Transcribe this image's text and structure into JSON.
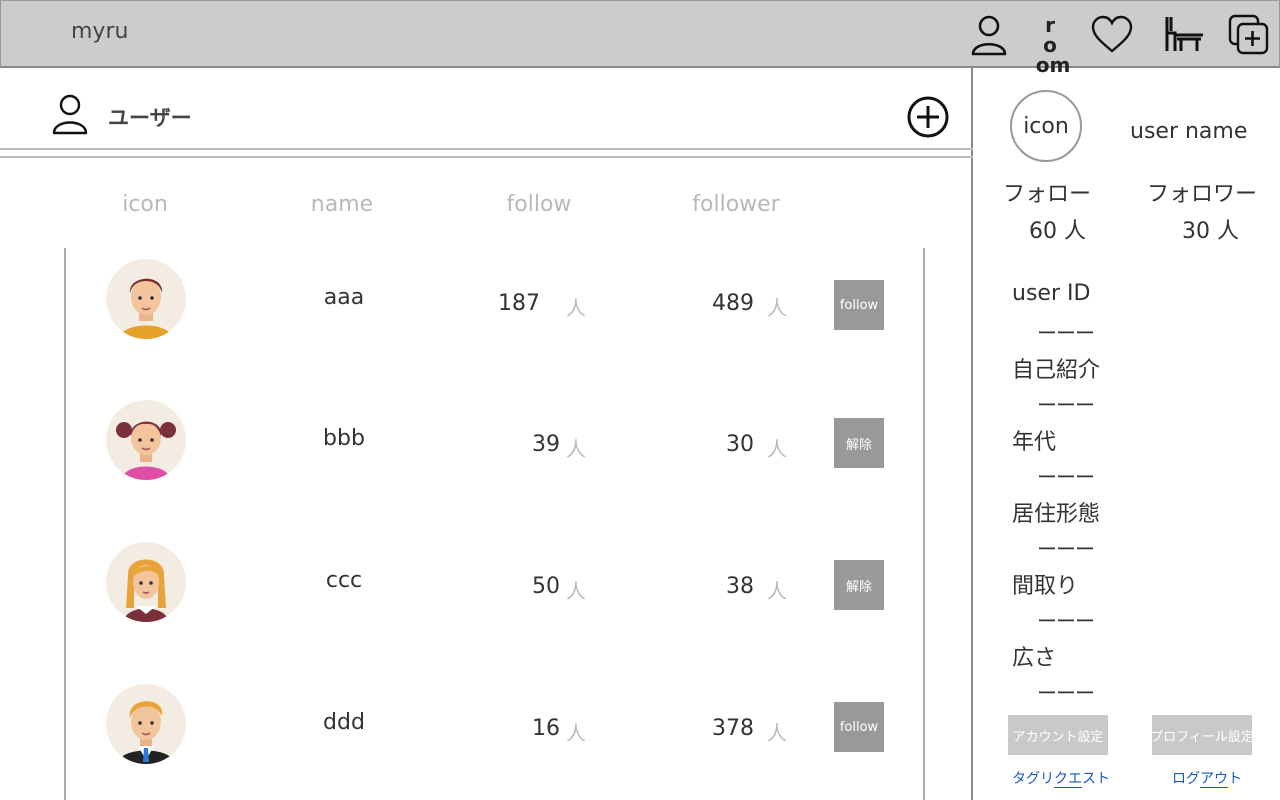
{
  "app": {
    "brand": "myru"
  },
  "topbar": {
    "icons": [
      "profile-icon",
      "room-icon",
      "heart-icon",
      "furniture-icon",
      "add-post-icon"
    ],
    "room_line1": "r o",
    "room_line2": "om"
  },
  "section": {
    "title": "ユーザー"
  },
  "table": {
    "headers": {
      "icon": "icon",
      "name": "name",
      "follow": "follow",
      "follower": "follower"
    },
    "unit": "人",
    "rows": [
      {
        "name": "aaa",
        "follow": "187",
        "follower": "489",
        "action": "follow",
        "avatar": "man-brown-hair"
      },
      {
        "name": "bbb",
        "follow": "39",
        "follower": "30",
        "action": "解除",
        "avatar": "girl-pigtails"
      },
      {
        "name": "ccc",
        "follow": "50",
        "follower": "38",
        "action": "解除",
        "avatar": "woman-blonde"
      },
      {
        "name": "ddd",
        "follow": "16",
        "follower": "378",
        "action": "follow",
        "avatar": "man-suit"
      }
    ]
  },
  "profile": {
    "icon_label": "icon",
    "user_name": "user name",
    "follow_label": "フォロー",
    "follow_value": "60 人",
    "follower_label": "フォロワー",
    "follower_value": "30 人",
    "fields": [
      {
        "label": "user ID",
        "value": "ーーー"
      },
      {
        "label": "自己紹介",
        "value": "ーーー"
      },
      {
        "label": "年代",
        "value": "ーーー"
      },
      {
        "label": "居住形態",
        "value": "ーーー"
      },
      {
        "label": "間取り",
        "value": "ーーー"
      },
      {
        "label": "広さ",
        "value": "ーーー"
      }
    ],
    "account_settings": "アカウント設定",
    "profile_settings": "プロフィール設定",
    "tag_request_pre": "タグリ",
    "tag_request_ul": "クエ",
    "tag_request_post": "スト",
    "logout_pre": "ログ",
    "logout_ul": "アウ",
    "logout_post": "ト"
  },
  "colors": {
    "topbar": "#cccccc",
    "button": "#999999",
    "side_button": "#c9c9c9",
    "link": "#1a56c4"
  }
}
